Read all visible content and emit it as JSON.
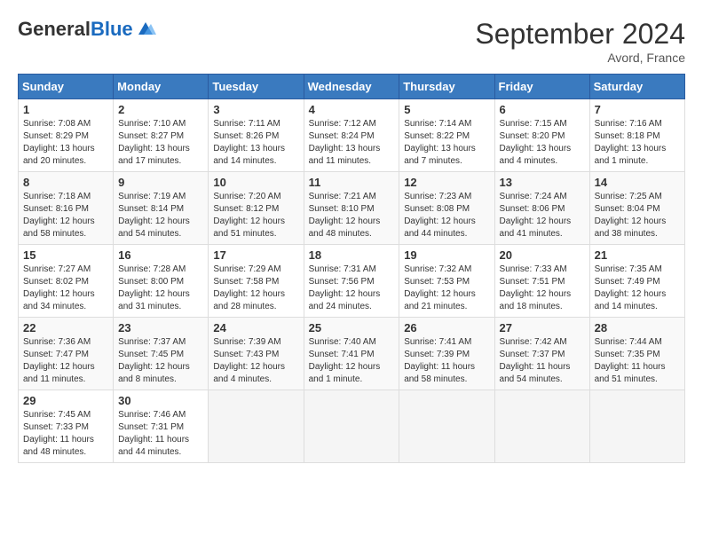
{
  "logo": {
    "general": "General",
    "blue": "Blue"
  },
  "title": "September 2024",
  "location": "Avord, France",
  "days_header": [
    "Sunday",
    "Monday",
    "Tuesday",
    "Wednesday",
    "Thursday",
    "Friday",
    "Saturday"
  ],
  "weeks": [
    [
      {
        "num": "1",
        "sunrise": "Sunrise: 7:08 AM",
        "sunset": "Sunset: 8:29 PM",
        "daylight": "Daylight: 13 hours and 20 minutes."
      },
      {
        "num": "2",
        "sunrise": "Sunrise: 7:10 AM",
        "sunset": "Sunset: 8:27 PM",
        "daylight": "Daylight: 13 hours and 17 minutes."
      },
      {
        "num": "3",
        "sunrise": "Sunrise: 7:11 AM",
        "sunset": "Sunset: 8:26 PM",
        "daylight": "Daylight: 13 hours and 14 minutes."
      },
      {
        "num": "4",
        "sunrise": "Sunrise: 7:12 AM",
        "sunset": "Sunset: 8:24 PM",
        "daylight": "Daylight: 13 hours and 11 minutes."
      },
      {
        "num": "5",
        "sunrise": "Sunrise: 7:14 AM",
        "sunset": "Sunset: 8:22 PM",
        "daylight": "Daylight: 13 hours and 7 minutes."
      },
      {
        "num": "6",
        "sunrise": "Sunrise: 7:15 AM",
        "sunset": "Sunset: 8:20 PM",
        "daylight": "Daylight: 13 hours and 4 minutes."
      },
      {
        "num": "7",
        "sunrise": "Sunrise: 7:16 AM",
        "sunset": "Sunset: 8:18 PM",
        "daylight": "Daylight: 13 hours and 1 minute."
      }
    ],
    [
      {
        "num": "8",
        "sunrise": "Sunrise: 7:18 AM",
        "sunset": "Sunset: 8:16 PM",
        "daylight": "Daylight: 12 hours and 58 minutes."
      },
      {
        "num": "9",
        "sunrise": "Sunrise: 7:19 AM",
        "sunset": "Sunset: 8:14 PM",
        "daylight": "Daylight: 12 hours and 54 minutes."
      },
      {
        "num": "10",
        "sunrise": "Sunrise: 7:20 AM",
        "sunset": "Sunset: 8:12 PM",
        "daylight": "Daylight: 12 hours and 51 minutes."
      },
      {
        "num": "11",
        "sunrise": "Sunrise: 7:21 AM",
        "sunset": "Sunset: 8:10 PM",
        "daylight": "Daylight: 12 hours and 48 minutes."
      },
      {
        "num": "12",
        "sunrise": "Sunrise: 7:23 AM",
        "sunset": "Sunset: 8:08 PM",
        "daylight": "Daylight: 12 hours and 44 minutes."
      },
      {
        "num": "13",
        "sunrise": "Sunrise: 7:24 AM",
        "sunset": "Sunset: 8:06 PM",
        "daylight": "Daylight: 12 hours and 41 minutes."
      },
      {
        "num": "14",
        "sunrise": "Sunrise: 7:25 AM",
        "sunset": "Sunset: 8:04 PM",
        "daylight": "Daylight: 12 hours and 38 minutes."
      }
    ],
    [
      {
        "num": "15",
        "sunrise": "Sunrise: 7:27 AM",
        "sunset": "Sunset: 8:02 PM",
        "daylight": "Daylight: 12 hours and 34 minutes."
      },
      {
        "num": "16",
        "sunrise": "Sunrise: 7:28 AM",
        "sunset": "Sunset: 8:00 PM",
        "daylight": "Daylight: 12 hours and 31 minutes."
      },
      {
        "num": "17",
        "sunrise": "Sunrise: 7:29 AM",
        "sunset": "Sunset: 7:58 PM",
        "daylight": "Daylight: 12 hours and 28 minutes."
      },
      {
        "num": "18",
        "sunrise": "Sunrise: 7:31 AM",
        "sunset": "Sunset: 7:56 PM",
        "daylight": "Daylight: 12 hours and 24 minutes."
      },
      {
        "num": "19",
        "sunrise": "Sunrise: 7:32 AM",
        "sunset": "Sunset: 7:53 PM",
        "daylight": "Daylight: 12 hours and 21 minutes."
      },
      {
        "num": "20",
        "sunrise": "Sunrise: 7:33 AM",
        "sunset": "Sunset: 7:51 PM",
        "daylight": "Daylight: 12 hours and 18 minutes."
      },
      {
        "num": "21",
        "sunrise": "Sunrise: 7:35 AM",
        "sunset": "Sunset: 7:49 PM",
        "daylight": "Daylight: 12 hours and 14 minutes."
      }
    ],
    [
      {
        "num": "22",
        "sunrise": "Sunrise: 7:36 AM",
        "sunset": "Sunset: 7:47 PM",
        "daylight": "Daylight: 12 hours and 11 minutes."
      },
      {
        "num": "23",
        "sunrise": "Sunrise: 7:37 AM",
        "sunset": "Sunset: 7:45 PM",
        "daylight": "Daylight: 12 hours and 8 minutes."
      },
      {
        "num": "24",
        "sunrise": "Sunrise: 7:39 AM",
        "sunset": "Sunset: 7:43 PM",
        "daylight": "Daylight: 12 hours and 4 minutes."
      },
      {
        "num": "25",
        "sunrise": "Sunrise: 7:40 AM",
        "sunset": "Sunset: 7:41 PM",
        "daylight": "Daylight: 12 hours and 1 minute."
      },
      {
        "num": "26",
        "sunrise": "Sunrise: 7:41 AM",
        "sunset": "Sunset: 7:39 PM",
        "daylight": "Daylight: 11 hours and 58 minutes."
      },
      {
        "num": "27",
        "sunrise": "Sunrise: 7:42 AM",
        "sunset": "Sunset: 7:37 PM",
        "daylight": "Daylight: 11 hours and 54 minutes."
      },
      {
        "num": "28",
        "sunrise": "Sunrise: 7:44 AM",
        "sunset": "Sunset: 7:35 PM",
        "daylight": "Daylight: 11 hours and 51 minutes."
      }
    ],
    [
      {
        "num": "29",
        "sunrise": "Sunrise: 7:45 AM",
        "sunset": "Sunset: 7:33 PM",
        "daylight": "Daylight: 11 hours and 48 minutes."
      },
      {
        "num": "30",
        "sunrise": "Sunrise: 7:46 AM",
        "sunset": "Sunset: 7:31 PM",
        "daylight": "Daylight: 11 hours and 44 minutes."
      },
      null,
      null,
      null,
      null,
      null
    ]
  ]
}
